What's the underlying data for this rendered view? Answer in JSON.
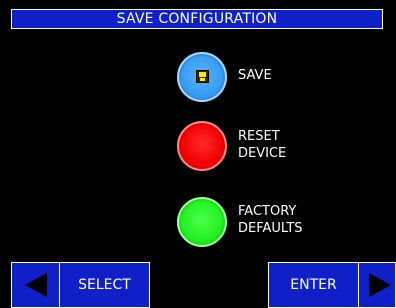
{
  "title": "SAVE CONFIGURATION",
  "actions": {
    "save": {
      "label": "SAVE",
      "icon": "floppy-disk-icon",
      "color": "#3a9ef2"
    },
    "reset": {
      "label_line1": "RESET",
      "label_line2": "DEVICE",
      "color": "#f20000"
    },
    "factory": {
      "label_line1": "FACTORY",
      "label_line2": "DEFAULTS",
      "color": "#21f021"
    }
  },
  "nav": {
    "left_icon": "left-arrow-icon",
    "select_label": "SELECT",
    "enter_label": "ENTER",
    "right_icon": "right-arrow-icon"
  },
  "colors": {
    "background": "#000000",
    "bar": "#0f20c8",
    "text": "#ffffff"
  }
}
